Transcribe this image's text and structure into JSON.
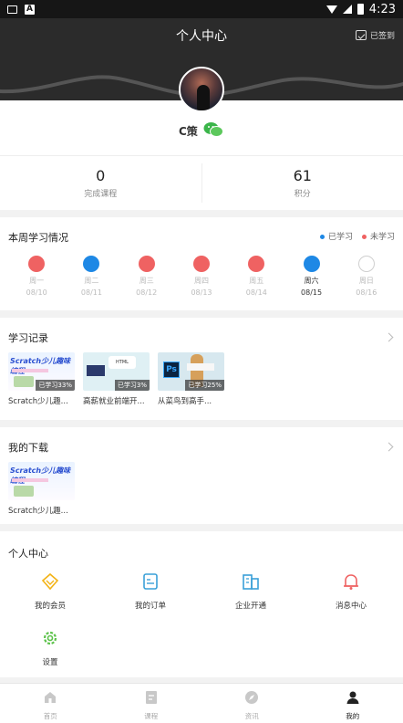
{
  "status_bar": {
    "time": "4:23"
  },
  "header": {
    "title": "个人中心",
    "signin_label": "已签到"
  },
  "profile": {
    "username": "C策"
  },
  "stats": [
    {
      "value": "0",
      "label": "完成课程"
    },
    {
      "value": "61",
      "label": "积分"
    }
  ],
  "week": {
    "title": "本周学习情况",
    "legend": {
      "learned": "已学习",
      "not_learned": "未学习"
    },
    "colors": {
      "learned": "#1e88e5",
      "not_learned": "#ef6262",
      "pending": "#ffffff"
    },
    "days": [
      {
        "name": "周一",
        "date": "08/10",
        "state": "not_learned"
      },
      {
        "name": "周二",
        "date": "08/11",
        "state": "learned"
      },
      {
        "name": "周三",
        "date": "08/12",
        "state": "not_learned"
      },
      {
        "name": "周四",
        "date": "08/13",
        "state": "not_learned"
      },
      {
        "name": "周五",
        "date": "08/14",
        "state": "not_learned"
      },
      {
        "name": "周六",
        "date": "08/15",
        "state": "learned",
        "today": true
      },
      {
        "name": "周日",
        "date": "08/16",
        "state": "pending"
      }
    ]
  },
  "history": {
    "title": "学习记录",
    "items": [
      {
        "title": "Scratch少儿趣...",
        "progress": "已学习33%",
        "image": "scratch",
        "image_text": "Scratch少儿趣味编程"
      },
      {
        "title": "高薪就业前端开...",
        "progress": "已学习3%",
        "image": "html",
        "image_text": "HTML"
      },
      {
        "title": "从菜鸟到高手...",
        "progress": "已学习25%",
        "image": "ps",
        "image_text": "Ps"
      }
    ]
  },
  "downloads": {
    "title": "我的下载",
    "items": [
      {
        "title": "Scratch少儿趣...",
        "image": "scratch",
        "image_text": "Scratch少儿趣味编程"
      }
    ]
  },
  "personal": {
    "title": "个人中心",
    "items": [
      {
        "label": "我的会员",
        "icon": "vip-diamond-icon",
        "color": "#f3b316"
      },
      {
        "label": "我的订单",
        "icon": "order-icon",
        "color": "#3aa0d8"
      },
      {
        "label": "企业开通",
        "icon": "building-icon",
        "color": "#3aa0d8"
      },
      {
        "label": "消息中心",
        "icon": "bell-icon",
        "color": "#ef6262"
      },
      {
        "label": "设置",
        "icon": "gear-icon",
        "color": "#5cc24a"
      }
    ]
  },
  "tabs": [
    {
      "label": "首页",
      "icon": "home-icon",
      "active": false
    },
    {
      "label": "课程",
      "icon": "course-icon",
      "active": false
    },
    {
      "label": "资讯",
      "icon": "compass-icon",
      "active": false
    },
    {
      "label": "我的",
      "icon": "user-icon",
      "active": true
    }
  ]
}
